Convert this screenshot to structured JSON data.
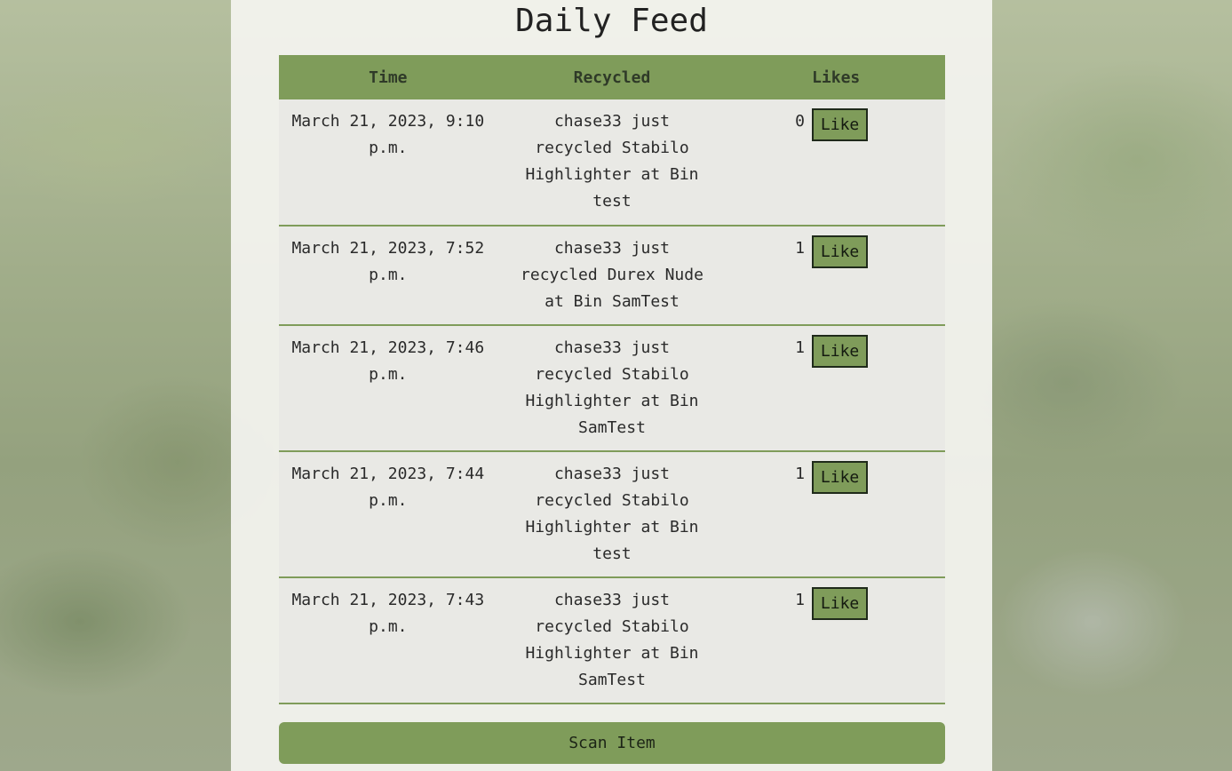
{
  "page_title": "Daily Feed",
  "table": {
    "headers": [
      "Time",
      "Recycled",
      "Likes"
    ],
    "rows": [
      {
        "time": "March 21, 2023, 9:10 p.m.",
        "recycled": "chase33 just recycled Stabilo Highlighter at Bin test",
        "likes": "0",
        "like_label": "Like"
      },
      {
        "time": "March 21, 2023, 7:52 p.m.",
        "recycled": "chase33 just recycled Durex Nude at Bin SamTest",
        "likes": "1",
        "like_label": "Like"
      },
      {
        "time": "March 21, 2023, 7:46 p.m.",
        "recycled": "chase33 just recycled Stabilo Highlighter at Bin SamTest",
        "likes": "1",
        "like_label": "Like"
      },
      {
        "time": "March 21, 2023, 7:44 p.m.",
        "recycled": "chase33 just recycled Stabilo Highlighter at Bin test",
        "likes": "1",
        "like_label": "Like"
      },
      {
        "time": "March 21, 2023, 7:43 p.m.",
        "recycled": "chase33 just recycled Stabilo Highlighter at Bin SamTest",
        "likes": "1",
        "like_label": "Like"
      }
    ]
  },
  "scan_button_label": "Scan Item",
  "colors": {
    "accent": "#7f9c5a",
    "panel": "#f4f4f0"
  }
}
